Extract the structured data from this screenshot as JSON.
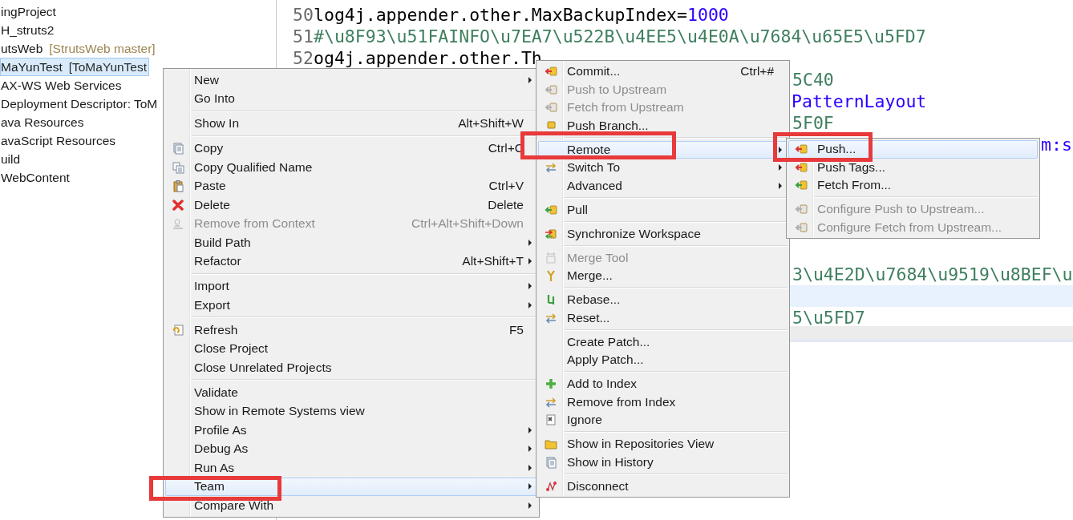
{
  "project_tree": {
    "items": [
      {
        "label": "ingProject",
        "selected": false
      },
      {
        "label": "H_struts2",
        "selected": false
      },
      {
        "label": "utsWeb",
        "decoration": "[StrutsWeb master]",
        "selected": false
      },
      {
        "label": "MaYunTest",
        "decoration": "[ToMaYunTest",
        "selected": true
      },
      {
        "label": "AX-WS Web Services",
        "selected": false
      },
      {
        "label": "Deployment Descriptor: ToM",
        "selected": false
      },
      {
        "label": "ava Resources",
        "selected": false
      },
      {
        "label": "avaScript Resources",
        "selected": false
      },
      {
        "label": "uild",
        "selected": false
      },
      {
        "label": "WebContent",
        "selected": false
      }
    ]
  },
  "editor": {
    "lines": [
      {
        "number": "50",
        "current": false,
        "segments": [
          {
            "text": "log4j.appender.other.MaxBackupIndex=",
            "kind": "key"
          },
          {
            "text": "1000",
            "kind": "value"
          }
        ]
      },
      {
        "number": "51",
        "current": false,
        "segments": [
          {
            "text": "#\\u8F93\\u51FAINFO\\u7EA7\\u522B\\u4EE5\\u4E0A\\u7684\\u65E5\\u5FD7",
            "kind": "comment"
          }
        ]
      },
      {
        "number": "52",
        "current": false,
        "segments": [
          {
            "text": "og4j.appender.other.Th",
            "kind": "key"
          }
        ]
      },
      {
        "current": false,
        "segments": [
          {
            "text": "5C40",
            "kind": "comment"
          }
        ]
      },
      {
        "current": false,
        "segments": [
          {
            "text": "PatternLayout",
            "kind": "value"
          }
        ]
      },
      {
        "current": false,
        "segments": [
          {
            "text": "5F0F",
            "kind": "comment"
          }
        ]
      },
      {
        "current": false,
        "segments": [
          {
            "text": "m:s",
            "kind": "value"
          }
        ]
      },
      {
        "current": false,
        "segments": [
          {
            "text": "3\\u4E2D\\u7684\\u9519\\u8BEF\\u",
            "kind": "comment"
          }
        ]
      },
      {
        "current": true
      },
      {
        "current": false,
        "segments": [
          {
            "text": "5\\u5FD7",
            "kind": "comment"
          }
        ]
      }
    ]
  },
  "context_menu": {
    "groups": [
      {
        "items": [
          {
            "label": "New",
            "submenu": true,
            "disabled": false,
            "selected": false
          },
          {
            "label": "Go Into",
            "submenu": false,
            "disabled": false,
            "selected": false
          }
        ]
      },
      {
        "items": [
          {
            "label": "Show In",
            "shortcut": "Alt+Shift+W",
            "submenu": false,
            "disabled": false,
            "selected": false
          }
        ]
      },
      {
        "items": [
          {
            "label": "Copy",
            "shortcut": "Ctrl+C",
            "submenu": false,
            "disabled": false,
            "selected": false
          },
          {
            "label": "Copy Qualified Name",
            "submenu": false,
            "disabled": false,
            "selected": false
          },
          {
            "label": "Paste",
            "shortcut": "Ctrl+V",
            "submenu": false,
            "disabled": false,
            "selected": false
          },
          {
            "label": "Delete",
            "shortcut": "Delete",
            "submenu": false,
            "disabled": false,
            "selected": false
          },
          {
            "label": "Remove from Context",
            "shortcut": "Ctrl+Alt+Shift+Down",
            "submenu": false,
            "disabled": true,
            "selected": false
          },
          {
            "label": "Build Path",
            "submenu": true,
            "disabled": false,
            "selected": false
          },
          {
            "label": "Refactor",
            "shortcut": "Alt+Shift+T",
            "submenu": true,
            "disabled": false,
            "selected": false
          }
        ]
      },
      {
        "items": [
          {
            "label": "Import",
            "submenu": true,
            "disabled": false,
            "selected": false
          },
          {
            "label": "Export",
            "submenu": true,
            "disabled": false,
            "selected": false
          }
        ]
      },
      {
        "items": [
          {
            "label": "Refresh",
            "shortcut": "F5",
            "submenu": false,
            "disabled": false,
            "selected": false
          },
          {
            "label": "Close Project",
            "submenu": false,
            "disabled": false,
            "selected": false
          },
          {
            "label": "Close Unrelated Projects",
            "submenu": false,
            "disabled": false,
            "selected": false
          }
        ]
      },
      {
        "items": [
          {
            "label": "Validate",
            "submenu": false,
            "disabled": false,
            "selected": false
          },
          {
            "label": "Show in Remote Systems view",
            "submenu": false,
            "disabled": false,
            "selected": false
          },
          {
            "label": "Profile As",
            "submenu": true,
            "disabled": false,
            "selected": false
          },
          {
            "label": "Debug As",
            "submenu": true,
            "disabled": false,
            "selected": false
          },
          {
            "label": "Run As",
            "submenu": true,
            "disabled": false,
            "selected": false
          },
          {
            "label": "Team",
            "submenu": true,
            "disabled": false,
            "selected": true
          },
          {
            "label": "Compare With",
            "submenu": true,
            "disabled": false,
            "selected": false
          }
        ]
      }
    ]
  },
  "team_menu": {
    "groups": [
      {
        "items": [
          {
            "label": "Commit...",
            "shortcut": "Ctrl+#",
            "submenu": false,
            "disabled": false,
            "selected": false
          },
          {
            "label": "Push to Upstream",
            "submenu": false,
            "disabled": true,
            "selected": false
          },
          {
            "label": "Fetch from Upstream",
            "submenu": false,
            "disabled": true,
            "selected": false
          },
          {
            "label": "Push Branch...",
            "submenu": false,
            "disabled": false,
            "selected": false
          }
        ]
      },
      {
        "items": [
          {
            "label": "Remote",
            "submenu": true,
            "disabled": false,
            "selected": true
          },
          {
            "label": "Switch To",
            "submenu": true,
            "disabled": false,
            "selected": false
          },
          {
            "label": "Advanced",
            "submenu": true,
            "disabled": false,
            "selected": false
          }
        ]
      },
      {
        "items": [
          {
            "label": "Pull",
            "submenu": false,
            "disabled": false,
            "selected": false
          }
        ]
      },
      {
        "items": [
          {
            "label": "Synchronize Workspace",
            "submenu": false,
            "disabled": false,
            "selected": false
          }
        ]
      },
      {
        "items": [
          {
            "label": "Merge Tool",
            "submenu": false,
            "disabled": true,
            "selected": false
          },
          {
            "label": "Merge...",
            "submenu": false,
            "disabled": false,
            "selected": false
          }
        ]
      },
      {
        "items": [
          {
            "label": "Rebase...",
            "submenu": false,
            "disabled": false,
            "selected": false
          },
          {
            "label": "Reset...",
            "submenu": false,
            "disabled": false,
            "selected": false
          }
        ]
      },
      {
        "items": [
          {
            "label": "Create Patch...",
            "submenu": false,
            "disabled": false,
            "selected": false
          },
          {
            "label": "Apply Patch...",
            "submenu": false,
            "disabled": false,
            "selected": false
          }
        ]
      },
      {
        "items": [
          {
            "label": "Add to Index",
            "submenu": false,
            "disabled": false,
            "selected": false
          },
          {
            "label": "Remove from Index",
            "submenu": false,
            "disabled": false,
            "selected": false
          },
          {
            "label": "Ignore",
            "submenu": false,
            "disabled": false,
            "selected": false
          }
        ]
      },
      {
        "items": [
          {
            "label": "Show in Repositories View",
            "submenu": false,
            "disabled": false,
            "selected": false
          },
          {
            "label": "Show in History",
            "submenu": false,
            "disabled": false,
            "selected": false
          }
        ]
      },
      {
        "items": [
          {
            "label": "Disconnect",
            "submenu": false,
            "disabled": false,
            "selected": false
          }
        ]
      }
    ]
  },
  "remote_menu": {
    "groups": [
      {
        "items": [
          {
            "label": "Push...",
            "submenu": false,
            "disabled": false,
            "selected": true
          },
          {
            "label": "Push Tags...",
            "submenu": false,
            "disabled": false,
            "selected": false
          },
          {
            "label": "Fetch From...",
            "submenu": false,
            "disabled": false,
            "selected": false
          }
        ]
      },
      {
        "items": [
          {
            "label": "Configure Push to Upstream...",
            "submenu": false,
            "disabled": true,
            "selected": false
          },
          {
            "label": "Configure Fetch from Upstream...",
            "submenu": false,
            "disabled": true,
            "selected": false
          }
        ]
      }
    ]
  }
}
